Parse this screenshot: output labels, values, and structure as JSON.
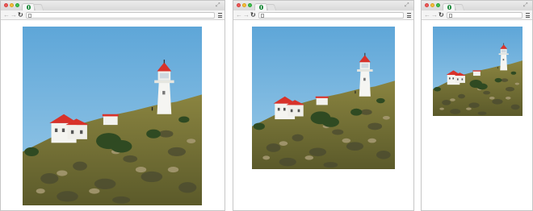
{
  "windows": [
    {
      "id": "large",
      "image_name": "lighthouse-photo"
    },
    {
      "id": "medium",
      "image_name": "lighthouse-photo"
    },
    {
      "id": "small",
      "image_name": "lighthouse-photo"
    }
  ],
  "icons": {
    "back": "back-arrow-icon",
    "forward": "forward-arrow-icon",
    "reload": "reload-icon",
    "menu": "menu-icon",
    "resize": "fullscreen-icon"
  },
  "colors": {
    "sky": "#6aaedc",
    "grass": "#7d7a3a",
    "roof": "#d8322a",
    "building": "#f4f4f0"
  },
  "omnibox": {
    "url": ""
  }
}
